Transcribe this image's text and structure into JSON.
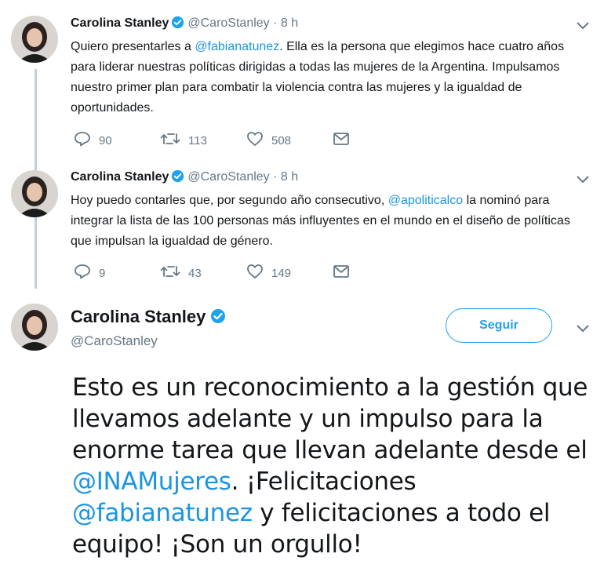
{
  "tweets": [
    {
      "name": "Carolina Stanley",
      "handle": "@CaroStanley",
      "separator": "·",
      "time": "8 h",
      "text_before": "Quiero presentarles a ",
      "mention": "@fabianatunez",
      "text_after": ". Ella es la persona que elegimos hace cuatro años para liderar nuestras políticas dirigidas a todas las mujeres de la Argentina. Impulsamos nuestro primer plan para combatir la violencia contra las mujeres y la igualdad de oportunidades.",
      "replies": "90",
      "retweets": "113",
      "likes": "508"
    },
    {
      "name": "Carolina Stanley",
      "handle": "@CaroStanley",
      "separator": "·",
      "time": "8 h",
      "text_before": "Hoy puedo contarles que, por segundo año consecutivo, ",
      "mention": "@apoliticalco",
      "text_after": " la nominó para integrar la lista de las 100 personas más influyentes en el mundo en el diseño de políticas que impulsan la igualdad de género.",
      "replies": "9",
      "retweets": "43",
      "likes": "149"
    }
  ],
  "main_tweet": {
    "name": "Carolina Stanley",
    "handle": "@CaroStanley",
    "follow_label": "Seguir",
    "text_1": "Esto es un reconocimiento a la gestión que llevamos adelante y un impulso para la enorme tarea que llevan adelante desde el ",
    "mention_1": "@INAMujeres",
    "text_2": ". ¡Felicitaciones ",
    "mention_2": "@fabianatunez",
    "text_3": " y felicitaciones a todo el equipo! ¡Son un orgullo!"
  },
  "icons": {
    "reply": "reply-icon",
    "retweet": "retweet-icon",
    "like": "heart-icon",
    "dm": "envelope-icon",
    "verified": "verified-badge-icon",
    "menu": "chevron-down-icon"
  },
  "colors": {
    "link": "#1b95e0",
    "verified": "#1da1f2",
    "muted": "#657786",
    "thread_line": "#c4cfd6"
  }
}
